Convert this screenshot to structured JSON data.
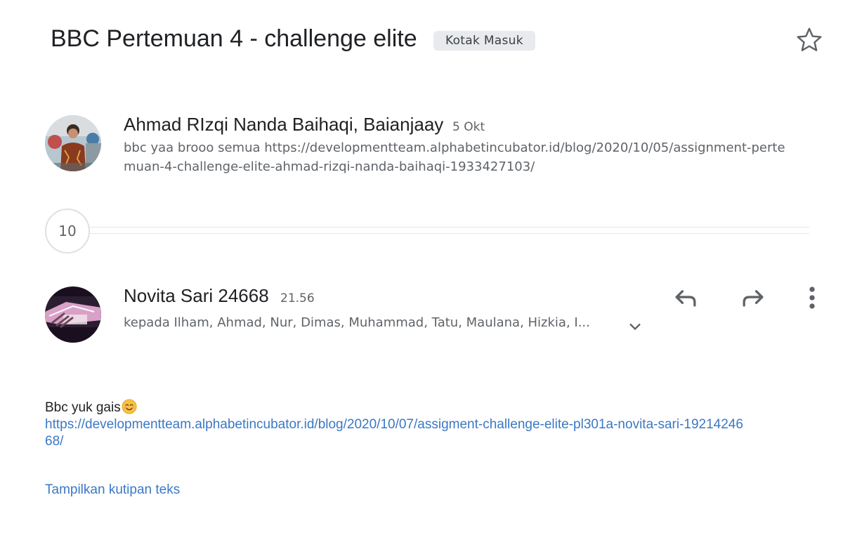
{
  "header": {
    "subject": "BBC Pertemuan 4 - challenge elite",
    "label": "Kotak Masuk",
    "star_icon": "star-outline-icon"
  },
  "collapsed_message": {
    "sender": "Ahmad RIzqi Nanda Baihaqi, Baianjaay",
    "date": "5 Okt",
    "snippet": "bbc yaa brooo semua https://developmentteam.alphabetincubator.id/blog/2020/10/05/assignment-pertemuan-4-challenge-elite-ahmad-rizqi-nanda-baihaqi-1933427103/"
  },
  "collapsed_count": "10",
  "open_message": {
    "sender": "Novita Sari 24668",
    "time": "21.56",
    "recipients": "kepada Ilham, Ahmad, Nur, Dimas, Muhammad, Tatu, Maulana, Hizkia, I...",
    "actions": {
      "reply_icon": "reply-icon",
      "forward_icon": "forward-icon",
      "more_icon": "more-vert-icon"
    },
    "body_text": "Bbc yuk gais",
    "emoji": "smiling-face-emoji",
    "body_link": "https://developmentteam.alphabetincubator.id/blog/2020/10/07/assigment-challenge-elite-pl301a-novita-sari-1921424668/",
    "show_quote": "Tampilkan kutipan teks"
  },
  "colors": {
    "link": "#3b78c4",
    "chip_bg": "#e8eaed",
    "secondary_text": "#5f6368"
  }
}
